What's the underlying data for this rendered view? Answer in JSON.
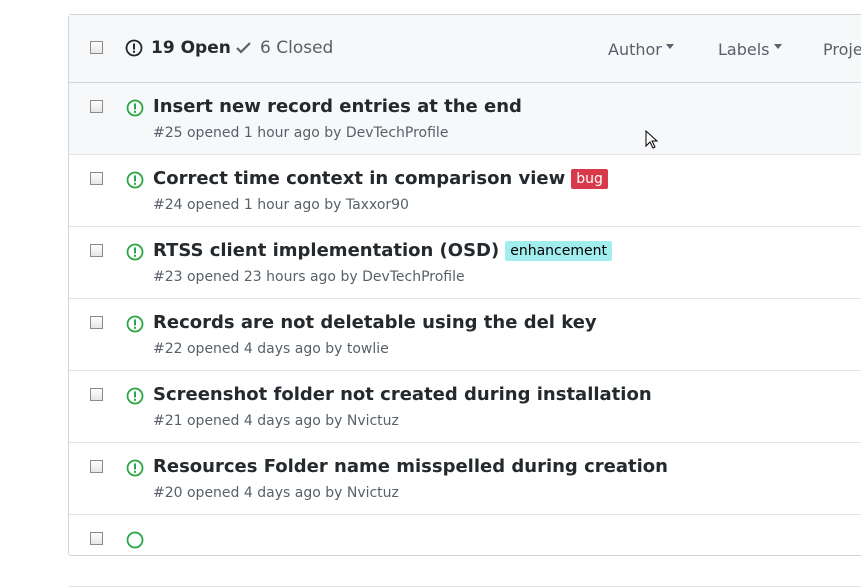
{
  "header": {
    "open_label": "19 Open",
    "closed_label": "6 Closed",
    "filters": [
      "Author",
      "Labels",
      "Proje"
    ]
  },
  "issues": [
    {
      "title": "Insert new record entries at the end",
      "meta": "#25 opened 1 hour ago by DevTechProfile",
      "label": null
    },
    {
      "title": "Correct time context in comparison view",
      "meta": "#24 opened 1 hour ago by Taxxor90",
      "label": {
        "text": "bug",
        "bg": "#d73a4a",
        "fg": "#ffffff"
      }
    },
    {
      "title": "RTSS client implementation (OSD)",
      "meta": "#23 opened 23 hours ago by DevTechProfile",
      "label": {
        "text": "enhancement",
        "bg": "#a2eeef",
        "fg": "#000000"
      }
    },
    {
      "title": "Records are not deletable using the del key",
      "meta": "#22 opened 4 days ago by towlie",
      "label": null
    },
    {
      "title": "Screenshot folder not created during installation",
      "meta": "#21 opened 4 days ago by Nvictuz",
      "label": null
    },
    {
      "title": "Resources Folder name misspelled during creation",
      "meta": "#20 opened 4 days ago by Nvictuz",
      "label": null
    }
  ],
  "colors": {
    "open_green": "#28a745"
  }
}
